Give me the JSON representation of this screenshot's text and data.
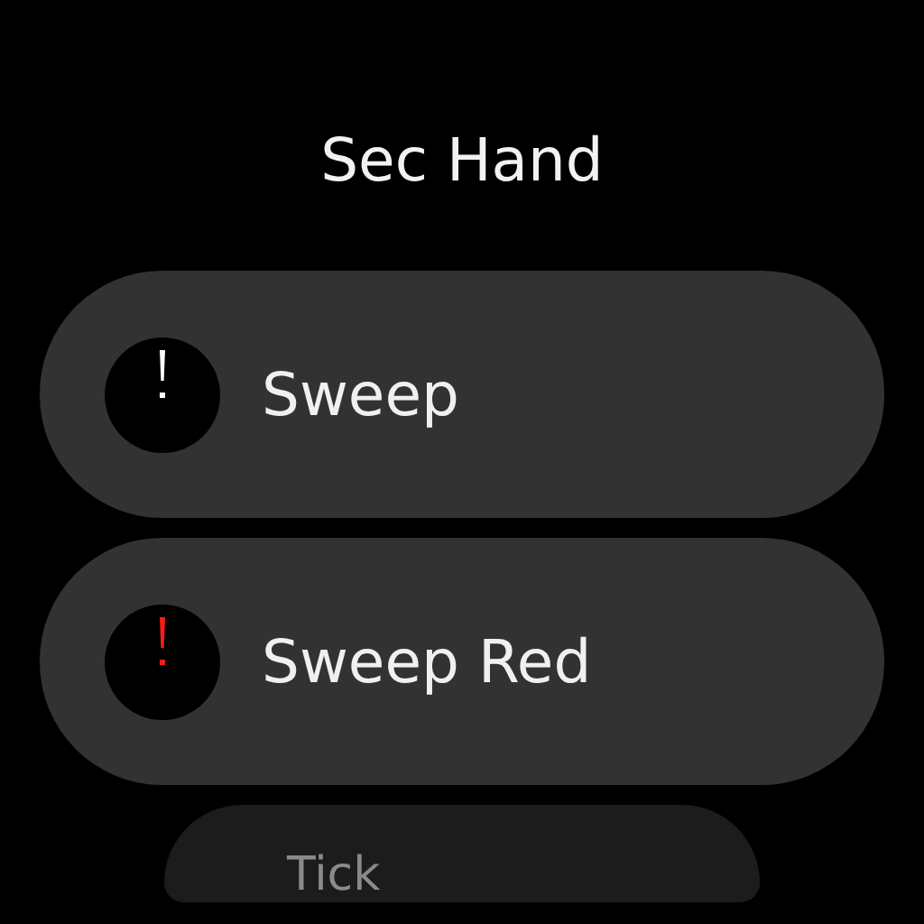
{
  "title": "Sec Hand",
  "options": [
    {
      "label": "Sweep",
      "color": "#ffffff",
      "faded": false
    },
    {
      "label": "Sweep Red",
      "color": "#ff1a1a",
      "faded": false
    },
    {
      "label": "Tick",
      "faded": true
    }
  ]
}
